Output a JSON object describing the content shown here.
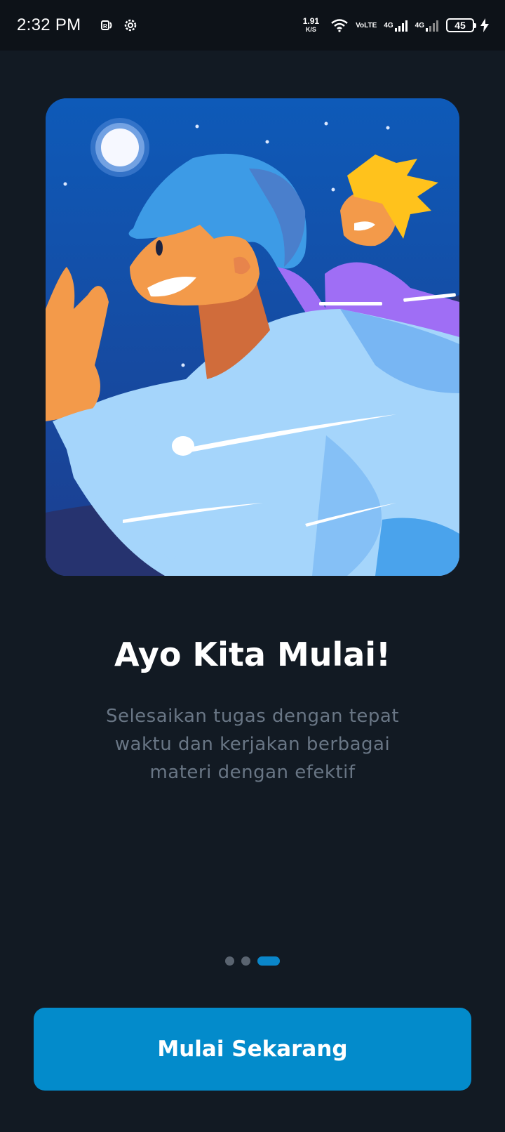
{
  "status_bar": {
    "time": "2:32 PM",
    "net_speed_value": "1.91",
    "net_speed_unit": "K/S",
    "volte_top": "Vo",
    "volte_bottom": "LTE",
    "sim1_label": "4G",
    "sim2_label": "4G",
    "battery_level": "45",
    "icons": [
      "nfc-icon",
      "settings-gear-icon",
      "wifi-icon",
      "volte-icon",
      "signal-icon",
      "signal-icon",
      "battery-icon",
      "charging-bolt-icon"
    ]
  },
  "onboarding": {
    "illustration": "night-sky-people-illustration",
    "title": "Ayo Kita Mulai!",
    "description": "Selesaikan tugas dengan tepat waktu dan kerjakan berbagai materi dengan efektif",
    "pagination": {
      "total": 3,
      "active_index": 2
    },
    "cta_label": "Mulai Sekarang"
  },
  "colors": {
    "background": "#121a23",
    "accent": "#038bcb",
    "subtitle": "#697685"
  }
}
